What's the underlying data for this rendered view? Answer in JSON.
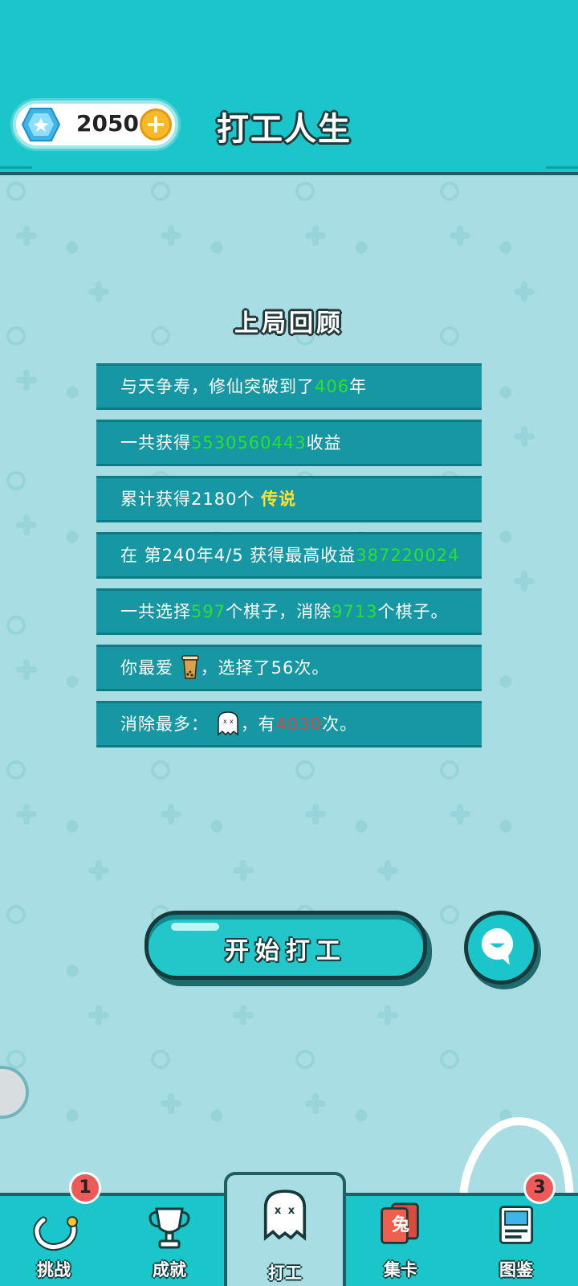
{
  "header": {
    "gem_count": "2050",
    "plus_label": "+",
    "title": "打工人生"
  },
  "review": {
    "title": "上局回顾",
    "rows": [
      {
        "pre": "与天争寿，修仙突破到了",
        "hl": "406",
        "post": "年"
      },
      {
        "pre": "一共获得",
        "hl": "5530560443",
        "post": "收益"
      },
      {
        "pre": "累计获得2180个 ",
        "hl": "传说",
        "post": ""
      },
      {
        "pre": "在 第240年4/5 获得最高收益",
        "hl": "387220024",
        "post": ""
      },
      {
        "pre": "一共选择",
        "hl": "597",
        "mid": "个棋子，消除",
        "hl2": "9713",
        "post": "个棋子。"
      },
      {
        "pre": "你最爱",
        "post": "，选择了56次。"
      },
      {
        "pre": "消除最多：",
        "mid": "，有",
        "hl": "4030",
        "post": "次。"
      }
    ]
  },
  "actions": {
    "start_label": "开始打工"
  },
  "nav": {
    "items": [
      {
        "label": "挑战",
        "badge": "1"
      },
      {
        "label": "成就"
      },
      {
        "label": "打工"
      },
      {
        "label": "集卡",
        "card_char": "兔"
      },
      {
        "label": "图鉴",
        "badge": "3"
      }
    ]
  },
  "colors": {
    "header_bg": "#1ac6c9",
    "page_bg": "#a9dde4",
    "row_bg": "#1797a4",
    "highlight_green": "#28e22a",
    "highlight_yellow": "#ffe12e",
    "highlight_red": "#d24a44"
  },
  "icons": [
    "diamond-gem-icon",
    "plus-icon",
    "bubble-tea-icon",
    "ghost-icon",
    "chat-icon",
    "ring-icon",
    "trophy-icon",
    "card-icon",
    "book-icon"
  ]
}
